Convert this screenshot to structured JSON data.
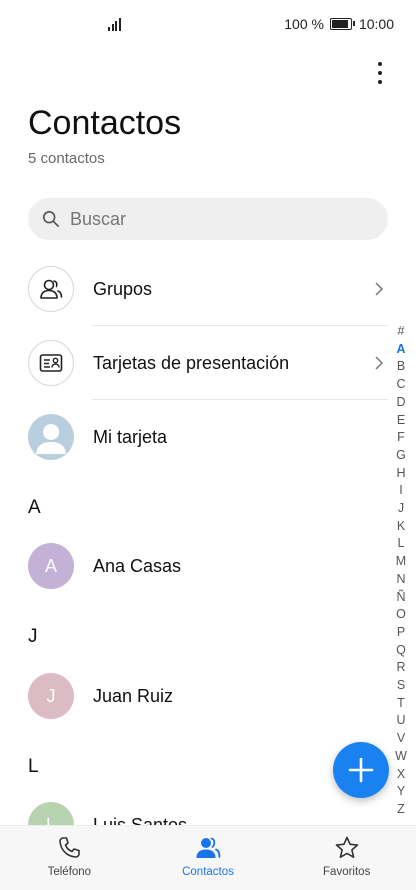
{
  "status_bar": {
    "battery": "100 %",
    "time": "10:00"
  },
  "header": {
    "title": "Contactos",
    "count": "5 contactos"
  },
  "search": {
    "placeholder": "Buscar"
  },
  "menu_rows": {
    "groups": "Grupos",
    "business_cards": "Tarjetas de presentación",
    "my_card": "Mi tarjeta"
  },
  "sections": [
    {
      "letter": "A",
      "contacts": [
        {
          "initial": "A",
          "name": "Ana Casas",
          "color": "#c3b1d6"
        }
      ]
    },
    {
      "letter": "J",
      "contacts": [
        {
          "initial": "J",
          "name": "Juan Ruiz",
          "color": "#dcbcc4"
        }
      ]
    },
    {
      "letter": "L",
      "contacts": [
        {
          "initial": "L",
          "name": "Luis Santos",
          "color": "#b7d3b0"
        }
      ]
    }
  ],
  "alphabet_index": [
    "#",
    "A",
    "B",
    "C",
    "D",
    "E",
    "F",
    "G",
    "H",
    "I",
    "J",
    "K",
    "L",
    "M",
    "N",
    "Ñ",
    "O",
    "P",
    "Q",
    "R",
    "S",
    "T",
    "U",
    "V",
    "W",
    "X",
    "Y",
    "Z"
  ],
  "alphabet_active": "A",
  "bottom_nav": [
    {
      "label": "Teléfono",
      "icon": "phone-icon",
      "active": false
    },
    {
      "label": "Contactos",
      "icon": "contacts-icon",
      "active": true
    },
    {
      "label": "Favoritos",
      "icon": "star-icon",
      "active": false
    }
  ],
  "colors": {
    "accent": "#1a73e8",
    "fab": "#1a82f0",
    "my_card_avatar": "#b9cfdd"
  }
}
